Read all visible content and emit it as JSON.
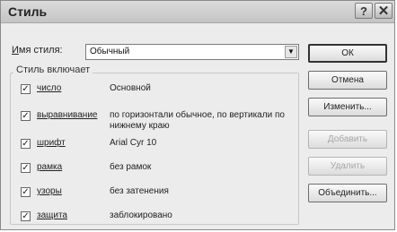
{
  "window": {
    "title": "Стиль",
    "help_label": "?",
    "close_label": "✕"
  },
  "style_name": {
    "label_u": "И",
    "label_rest": "мя стиля:",
    "value": "Обычный",
    "arrow": "▼"
  },
  "includes": {
    "label": "Стиль включает",
    "check_mark": "✓",
    "items": [
      {
        "name": "число",
        "value": "Основной"
      },
      {
        "name": "выравнивание",
        "value": "по горизонтали обычное, по вертикали по нижнему краю"
      },
      {
        "name": "шрифт",
        "value": "Arial Cyr 10"
      },
      {
        "name": "рамка",
        "value": "без рамок"
      },
      {
        "name": "узоры",
        "value": "без затенения"
      },
      {
        "name": "защита",
        "value": "заблокировано"
      }
    ]
  },
  "buttons": {
    "ok": "ОК",
    "cancel": "Отмена",
    "modify": "Изменить...",
    "add": "Добавить",
    "delete": "Удалить",
    "merge": "Объединить..."
  }
}
